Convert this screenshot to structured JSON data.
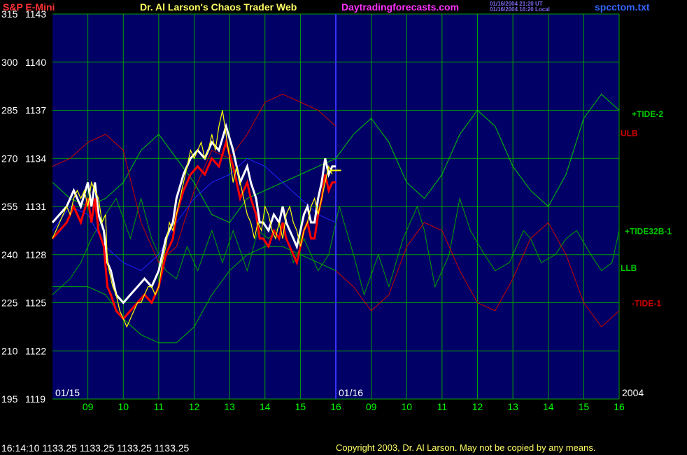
{
  "header": {
    "instrument": "S&P E-Mini",
    "title": "Dr. Al Larson's Chaos Trader Web",
    "site": "Daytradingforecasts.com",
    "timestamp_ut": "01/16/2004 21:20 UT",
    "timestamp_local": "01/16/2004 16:20 Local",
    "filename": "spcctom.txt"
  },
  "footer": {
    "quote": "16:14:10 1133.25 1133.25 1133.25 1133.25",
    "copyright": "Copyright 2003, Dr. Al Larson. May not be copied by any means."
  },
  "colors": {
    "background": "#000000",
    "plot_background": "#000066",
    "grid": "#00a000",
    "price_up": "#ffffff",
    "price_down": "#ff0000",
    "tide2": "#00c800",
    "tide32b": "#00a000",
    "tide1": "#cc0000",
    "llb": "#00b000",
    "ulb": "#cc0000",
    "blue_line": "#2222ff",
    "yellow": "#ffff00",
    "header_red": "#ff3333",
    "header_yellow": "#ffff66",
    "header_magenta": "#ff33ff",
    "header_blue": "#3366ff"
  },
  "chart_data": {
    "type": "line",
    "ylim": [
      1119,
      1143
    ],
    "left_scale_labels": [
      "315",
      "300",
      "285",
      "270",
      "255",
      "240",
      "225",
      "210",
      "195"
    ],
    "right_scale_labels": [
      "1143",
      "1140",
      "1137",
      "1134",
      "1131",
      "1128",
      "1125",
      "1122",
      "1119"
    ],
    "price_gridlines": [
      1143,
      1140,
      1137,
      1134,
      1131,
      1128,
      1125,
      1122,
      1119
    ],
    "x_hour_labels": [
      "09",
      "10",
      "11",
      "12",
      "13",
      "14",
      "15",
      "16",
      "09",
      "10",
      "11",
      "12",
      "13",
      "14",
      "15",
      "16"
    ],
    "x_hour_positions": [
      8.5,
      9.5,
      10.5,
      11.5,
      12.5,
      13.5,
      14.5,
      15.5,
      16.5,
      17.5,
      18.5,
      19.5,
      20.5,
      21.5,
      22.5,
      23.5
    ],
    "xlim": [
      7.5,
      23.5
    ],
    "session_split": 15.5,
    "date_labels": [
      "01/15",
      "01/16",
      "2004"
    ],
    "last_price": 1133.25,
    "line_labels": [
      "+TIDE-2",
      "ULB",
      "+TIDE32B-1",
      "LLB",
      "-TIDE-1"
    ],
    "series": [
      {
        "id": "tide2",
        "x": [
          7.5,
          8.0,
          8.5,
          9.0,
          9.5,
          10.0,
          10.5,
          11.0,
          11.5,
          12.0,
          12.5,
          13.0,
          13.5,
          14.0,
          14.5,
          15.0,
          15.5,
          16.0,
          16.5,
          17.0,
          17.5,
          18.0,
          18.5,
          19.0,
          19.5,
          20.0,
          20.5,
          21.0,
          21.5,
          22.0,
          22.5,
          23.0,
          23.5
        ],
        "y": [
          1132.5,
          1131.5,
          1131.0,
          1131.5,
          1132.5,
          1134.5,
          1135.5,
          1134.0,
          1132.5,
          1130.5,
          1130.0,
          1131.5,
          1132.0,
          1132.5,
          1133.0,
          1133.5,
          1134.0,
          1135.5,
          1136.5,
          1135.0,
          1132.5,
          1131.5,
          1133.0,
          1135.5,
          1137.0,
          1136.0,
          1133.5,
          1132.0,
          1131.0,
          1133.0,
          1136.5,
          1138.0,
          1137.0
        ]
      },
      {
        "id": "tide32b",
        "x": [
          7.5,
          8.0,
          8.3,
          8.6,
          9.0,
          9.3,
          9.7,
          10.0,
          10.3,
          10.7,
          11.0,
          11.3,
          11.6,
          12.0,
          12.3,
          12.6,
          13.0,
          13.3,
          13.6,
          14.0,
          14.3,
          14.6,
          15.0,
          15.3,
          15.6,
          16.0,
          16.3,
          16.7,
          17.0,
          17.4,
          17.8,
          18.0,
          18.3,
          18.7,
          19.0,
          19.3,
          19.7,
          20.0,
          20.4,
          20.8,
          21.0,
          21.3,
          21.7,
          22.0,
          22.3,
          22.7,
          23.0,
          23.3,
          23.5
        ],
        "y": [
          1125.5,
          1126.5,
          1127.5,
          1129.0,
          1130.5,
          1131.5,
          1129.0,
          1131.5,
          1129.0,
          1127.0,
          1126.5,
          1128.5,
          1127.0,
          1129.5,
          1127.5,
          1129.5,
          1127.0,
          1129.5,
          1129.0,
          1130.0,
          1127.5,
          1129.0,
          1127.0,
          1128.0,
          1131.0,
          1128.0,
          1125.5,
          1128.0,
          1126.0,
          1129.0,
          1131.0,
          1129.5,
          1126.0,
          1128.0,
          1131.5,
          1129.5,
          1128.0,
          1127.0,
          1127.5,
          1129.5,
          1129.0,
          1127.5,
          1128.0,
          1129.0,
          1129.5,
          1128.0,
          1127.0,
          1127.5,
          1129.5
        ]
      },
      {
        "id": "tide1",
        "x": [
          15.5,
          16.0,
          16.5,
          17.0,
          17.5,
          18.0,
          18.5,
          19.0,
          19.5,
          20.0,
          20.5,
          21.0,
          21.5,
          22.0,
          22.5,
          23.0,
          23.5
        ],
        "y": [
          1127.0,
          1126.0,
          1124.5,
          1125.5,
          1128.5,
          1130.0,
          1129.5,
          1127.0,
          1125.0,
          1124.5,
          1126.5,
          1129.0,
          1130.0,
          1128.0,
          1125.0,
          1123.5,
          1124.5
        ]
      },
      {
        "id": "ulb",
        "x": [
          7.5,
          8.0,
          8.5,
          9.0,
          9.5,
          10.0,
          10.5,
          11.0,
          11.5,
          12.0,
          12.5,
          13.0,
          13.5,
          14.0,
          14.5,
          15.0,
          15.5
        ],
        "y": [
          1133.5,
          1134.0,
          1135.0,
          1135.5,
          1134.5,
          1130.0,
          1127.5,
          1128.5,
          1132.0,
          1134.5,
          1134.0,
          1135.5,
          1137.5,
          1138.0,
          1137.5,
          1137.0,
          1136.0
        ]
      },
      {
        "id": "llb",
        "x": [
          7.5,
          8.0,
          8.5,
          9.0,
          9.5,
          10.0,
          10.5,
          11.0,
          11.5,
          12.0,
          12.5,
          13.0,
          13.5,
          14.0,
          14.5,
          15.0,
          15.5
        ],
        "y": [
          1126.0,
          1126.0,
          1126.0,
          1125.5,
          1124.0,
          1123.0,
          1122.5,
          1122.5,
          1123.5,
          1125.5,
          1127.0,
          1128.0,
          1128.5,
          1128.5,
          1128.0,
          1127.5,
          1127.0
        ]
      },
      {
        "id": "blue",
        "x": [
          7.5,
          8.0,
          8.5,
          9.0,
          9.5,
          10.0,
          10.5,
          11.0,
          11.5,
          12.0,
          12.5,
          13.0,
          13.5,
          14.0,
          14.5,
          15.0,
          15.5
        ],
        "y": [
          1129.5,
          1131.0,
          1130.5,
          1128.5,
          1127.5,
          1127.0,
          1128.0,
          1130.0,
          1131.5,
          1132.5,
          1133.0,
          1134.0,
          1133.5,
          1132.5,
          1131.5,
          1130.5,
          1130.0
        ]
      },
      {
        "id": "price_upper",
        "x": [
          7.5,
          7.7,
          7.9,
          8.1,
          8.3,
          8.5,
          8.6,
          8.7,
          8.8,
          8.95,
          9.05,
          9.15,
          9.3,
          9.5,
          9.7,
          9.9,
          10.1,
          10.3,
          10.5,
          10.7,
          10.9,
          11.0,
          11.2,
          11.4,
          11.6,
          11.8,
          12.0,
          12.2,
          12.4,
          12.6,
          12.8,
          13.0,
          13.1,
          13.25,
          13.35,
          13.45,
          13.6,
          13.75,
          13.9,
          14.0,
          14.1,
          14.2,
          14.3,
          14.4,
          14.5,
          14.6,
          14.7,
          14.8,
          14.9,
          15.0,
          15.1,
          15.2,
          15.3,
          15.4,
          15.5
        ],
        "y": [
          1130.0,
          1130.5,
          1131.0,
          1132.0,
          1131.0,
          1132.5,
          1131.0,
          1132.5,
          1130.5,
          1129.5,
          1127.5,
          1127.0,
          1125.5,
          1125.0,
          1125.5,
          1126.0,
          1126.5,
          1126.0,
          1127.0,
          1129.0,
          1130.0,
          1131.5,
          1133.0,
          1134.0,
          1134.5,
          1134.0,
          1135.0,
          1134.5,
          1136.0,
          1134.5,
          1132.5,
          1133.5,
          1132.5,
          1131.5,
          1130.0,
          1130.0,
          1129.5,
          1130.5,
          1130.0,
          1131.0,
          1130.0,
          1129.5,
          1129.0,
          1128.5,
          1129.5,
          1130.5,
          1131.0,
          1130.0,
          1130.0,
          1131.5,
          1132.5,
          1134.0,
          1133.0,
          1133.5,
          1133.5
        ]
      },
      {
        "id": "price_lower",
        "x": [
          7.5,
          7.7,
          7.9,
          8.1,
          8.3,
          8.5,
          8.6,
          8.7,
          8.8,
          8.95,
          9.05,
          9.15,
          9.3,
          9.5,
          9.7,
          9.9,
          10.1,
          10.3,
          10.5,
          10.7,
          10.9,
          11.0,
          11.2,
          11.4,
          11.6,
          11.8,
          12.0,
          12.2,
          12.4,
          12.6,
          12.8,
          13.0,
          13.1,
          13.25,
          13.35,
          13.45,
          13.6,
          13.75,
          13.9,
          14.0,
          14.1,
          14.2,
          14.3,
          14.4,
          14.5,
          14.6,
          14.7,
          14.8,
          14.9,
          15.0,
          15.1,
          15.2,
          15.3,
          15.4,
          15.5
        ],
        "y": [
          1129.0,
          1129.5,
          1130.0,
          1131.0,
          1130.0,
          1131.5,
          1130.0,
          1131.5,
          1129.5,
          1128.5,
          1126.0,
          1125.5,
          1124.5,
          1124.0,
          1124.5,
          1125.0,
          1125.5,
          1125.0,
          1126.0,
          1128.0,
          1129.0,
          1130.5,
          1132.0,
          1133.0,
          1133.5,
          1133.0,
          1134.0,
          1133.5,
          1135.0,
          1133.5,
          1131.5,
          1132.5,
          1131.5,
          1130.5,
          1129.0,
          1129.0,
          1128.5,
          1129.5,
          1129.0,
          1130.0,
          1129.0,
          1128.5,
          1128.0,
          1127.5,
          1128.5,
          1129.5,
          1130.0,
          1129.0,
          1129.0,
          1130.5,
          1131.5,
          1133.0,
          1132.0,
          1132.5,
          1132.5
        ]
      },
      {
        "id": "price",
        "x": [
          7.5,
          7.6,
          7.7,
          7.8,
          7.9,
          8.0,
          8.1,
          8.2,
          8.3,
          8.4,
          8.5,
          8.6,
          8.7,
          8.8,
          8.9,
          9.0,
          9.05,
          9.1,
          9.2,
          9.3,
          9.4,
          9.5,
          9.6,
          9.7,
          9.8,
          9.9,
          10.0,
          10.1,
          10.2,
          10.3,
          10.4,
          10.5,
          10.6,
          10.7,
          10.8,
          10.9,
          11.0,
          11.1,
          11.2,
          11.3,
          11.4,
          11.5,
          11.6,
          11.7,
          11.8,
          11.9,
          12.0,
          12.1,
          12.2,
          12.3,
          12.4,
          12.5,
          12.6,
          12.7,
          12.8,
          12.9,
          13.0,
          13.1,
          13.2,
          13.3,
          13.4,
          13.5,
          13.6,
          13.7,
          13.8,
          13.9,
          14.0,
          14.1,
          14.2,
          14.3,
          14.4,
          14.5,
          14.6,
          14.7,
          14.8,
          14.9,
          15.0,
          15.1,
          15.2,
          15.3,
          15.4
        ],
        "y": [
          1129.0,
          1129.5,
          1130.0,
          1130.5,
          1131.0,
          1130.5,
          1131.5,
          1132.0,
          1131.5,
          1132.0,
          1131.0,
          1132.5,
          1132.0,
          1131.5,
          1130.0,
          1130.5,
          1127.5,
          1127.0,
          1126.0,
          1125.5,
          1124.5,
          1124.0,
          1123.5,
          1124.0,
          1124.5,
          1125.0,
          1125.0,
          1125.5,
          1126.0,
          1126.0,
          1125.5,
          1126.0,
          1127.5,
          1128.5,
          1130.0,
          1129.5,
          1130.5,
          1131.5,
          1132.5,
          1133.5,
          1134.5,
          1134.0,
          1134.5,
          1135.0,
          1134.0,
          1134.5,
          1135.5,
          1134.5,
          1136.0,
          1137.0,
          1135.5,
          1134.0,
          1132.5,
          1133.5,
          1132.5,
          1131.5,
          1130.5,
          1130.0,
          1129.0,
          1130.0,
          1129.5,
          1131.0,
          1130.5,
          1129.5,
          1129.0,
          1130.0,
          1129.0,
          1130.5,
          1131.0,
          1130.0,
          1129.5,
          1128.5,
          1129.5,
          1130.0,
          1131.0,
          1131.5,
          1130.5,
          1131.5,
          1132.5,
          1133.5,
          1133.0
        ]
      }
    ],
    "last_tick": {
      "x": [
        15.35,
        15.65
      ],
      "y": 1133.25
    }
  }
}
